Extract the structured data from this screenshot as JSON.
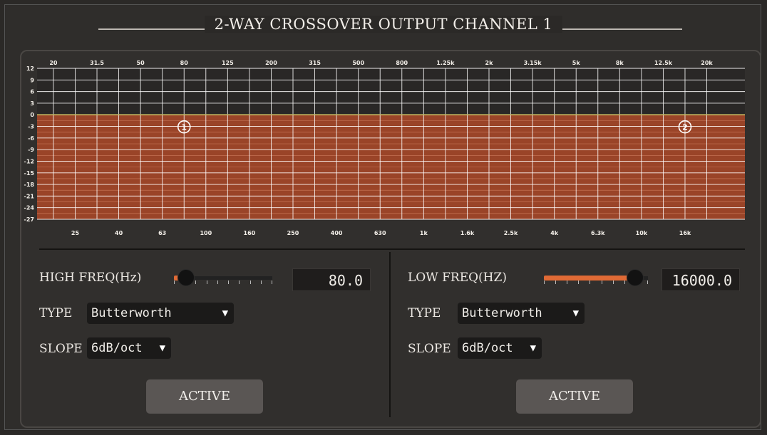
{
  "title": "2-WAY CROSSOVER OUTPUT CHANNEL 1",
  "graph": {
    "y_ticks": [
      "12",
      "9",
      "6",
      "3",
      "0",
      "-3",
      "-6",
      "-9",
      "-12",
      "-15",
      "-18",
      "-21",
      "-24",
      "-27"
    ],
    "top_freq_labels": [
      "20",
      "31.5",
      "50",
      "80",
      "125",
      "200",
      "315",
      "500",
      "800",
      "1.25k",
      "2k",
      "3.15k",
      "5k",
      "8k",
      "12.5k",
      "20k"
    ],
    "bottom_freq_labels": [
      "25",
      "40",
      "63",
      "100",
      "160",
      "250",
      "400",
      "630",
      "1k",
      "1.6k",
      "2.5k",
      "4k",
      "6.3k",
      "10k",
      "16k"
    ],
    "markers": [
      "①",
      "②"
    ],
    "colors": {
      "passband": "#9a4428",
      "grid": "#ffffff",
      "line": "#c8b860",
      "background": "#292726"
    }
  },
  "left": {
    "freq_label": "HIGH FREQ(Hz)",
    "freq_value": "80.0",
    "slider_fraction": 0.12,
    "type_label": "TYPE",
    "type_value": "Butterworth",
    "slope_label": "SLOPE",
    "slope_value": "6dB/oct",
    "active_label": "ACTIVE"
  },
  "right": {
    "freq_label": "LOW FREQ(HZ)",
    "freq_value": "16000.0",
    "slider_fraction": 0.88,
    "type_label": "TYPE",
    "type_value": "Butterworth",
    "slope_label": "SLOPE",
    "slope_value": "6dB/oct",
    "active_label": "ACTIVE"
  },
  "icons": {
    "dropdown": "dropdown-arrow-icon",
    "slider_knob": "slider-knob-icon"
  }
}
